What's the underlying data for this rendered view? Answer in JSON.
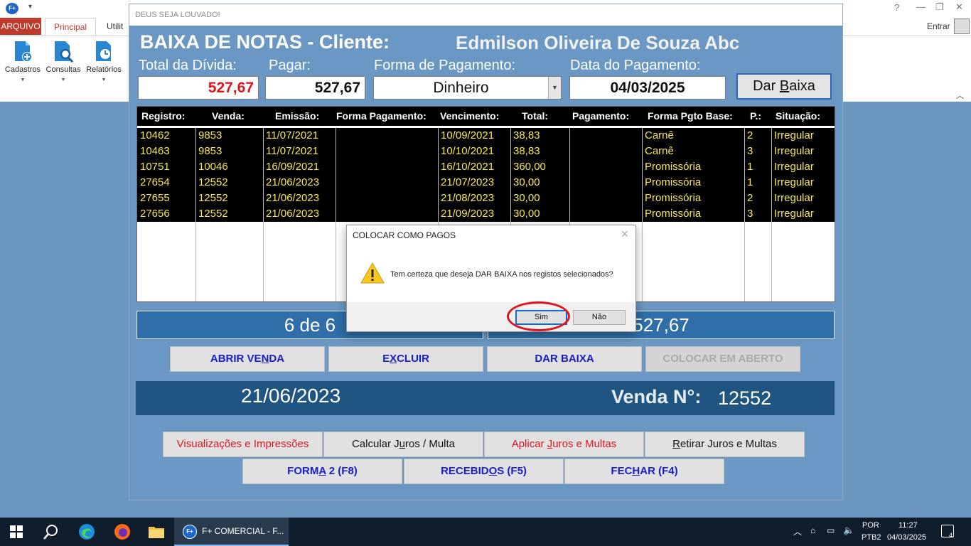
{
  "ribbon": {
    "tabs": {
      "arquivo": "ARQUIVO",
      "principal": "Principal",
      "utilitarios": "Utilit"
    },
    "buttons": {
      "cadastros": "Cadastros",
      "consultas": "Consultas",
      "relatorios": "Relatórios"
    },
    "entrar": "Entrar",
    "logo": "F+"
  },
  "form": {
    "window_title": "DEUS SEJA LOUVADO!",
    "title": "BAIXA DE NOTAS - Cliente:",
    "client_name": "Edmilson Oliveira De Souza Abc",
    "labels": {
      "total_divida": "Total da Dívida:",
      "pagar": "Pagar:",
      "forma_pagamento": "Forma de Pagamento:",
      "data_pagamento": "Data do Pagamento:"
    },
    "values": {
      "total_divida": "527,67",
      "pagar": "527,67",
      "forma_pagamento": "Dinheiro",
      "data_pagamento": "04/03/2025"
    },
    "dar_baixa_top": {
      "pre": "Dar ",
      "key": "B",
      "post": "aixa"
    }
  },
  "grid": {
    "headers": [
      "Registro:",
      "Venda:",
      "Emissão:",
      "Forma Pagamento:",
      "Vencimento:",
      "Total:",
      "Pagamento:",
      "Forma Pgto Base:",
      "P.:",
      "Situação:"
    ],
    "rows": [
      [
        "10462",
        "9853",
        "11/07/2021",
        "",
        "10/09/2021",
        "38,83",
        "",
        "Carnê",
        "2",
        "Irregular"
      ],
      [
        "10463",
        "9853",
        "11/07/2021",
        "",
        "10/10/2021",
        "38,83",
        "",
        "Carnê",
        "3",
        "Irregular"
      ],
      [
        "10751",
        "10046",
        "16/09/2021",
        "",
        "16/10/2021",
        "360,00",
        "",
        "Promissória",
        "1",
        "Irregular"
      ],
      [
        "27654",
        "12552",
        "21/06/2023",
        "",
        "21/07/2023",
        "30,00",
        "",
        "Promissória",
        "1",
        "Irregular"
      ],
      [
        "27655",
        "12552",
        "21/06/2023",
        "",
        "21/08/2023",
        "30,00",
        "",
        "Promissória",
        "2",
        "Irregular"
      ],
      [
        "27656",
        "12552",
        "21/06/2023",
        "",
        "21/09/2023",
        "30,00",
        "",
        "Promissória",
        "3",
        "Irregular"
      ]
    ]
  },
  "summary": {
    "count": "6 de 6",
    "total": "527,67"
  },
  "actions": {
    "abrir_venda": {
      "pre": "ABRIR VE",
      "key": "N",
      "post": "DA"
    },
    "excluir": {
      "pre": "E",
      "key": "X",
      "post": "CLUIR"
    },
    "dar_baixa": "DAR BAIXA",
    "colocar_em_aberto": "COLOCAR EM ABERTO"
  },
  "info": {
    "date": "21/06/2023",
    "venda_label": "Venda N°:",
    "venda_num": "12552"
  },
  "bottom": {
    "visualizacoes": "Visualizações e Impressões",
    "calcular": {
      "pre": "Calcular J",
      "key": "u",
      "post": "ros / Multa"
    },
    "aplicar": {
      "pre": "Aplicar ",
      "key": "J",
      "post": "uros e Multas"
    },
    "retirar": {
      "pre": "",
      "key": "R",
      "post": "etirar Juros e Multas"
    },
    "forma2": {
      "pre": "FORM",
      "key": "A",
      "post": " 2 (F8)"
    },
    "recebidos": {
      "pre": "RECEBID",
      "key": "O",
      "post": "S (F5)"
    },
    "fechar": {
      "pre": "FEC",
      "key": "H",
      "post": "AR (F4)"
    }
  },
  "dialog": {
    "title": "COLOCAR COMO PAGOS",
    "message": "Tem certeza que deseja DAR BAIXA nos registos selecionados?",
    "sim": "Sim",
    "nao": "Não"
  },
  "taskbar": {
    "app_label": "F+ COMERCIAL - F...",
    "lang1": "POR",
    "lang2": "PTB2",
    "time": "11:27",
    "date": "04/03/2025",
    "notif_count": "4"
  },
  "colors": {
    "accent_red": "#e0141e",
    "grid_text": "#f7e94a",
    "action_blue": "#1a1ad0",
    "form_bg": "#6a97c3"
  },
  "icons": [
    "app-logo-icon",
    "cadastros-icon",
    "consultas-icon",
    "relatorios-icon",
    "warning-icon",
    "windows-start-icon",
    "search-icon",
    "edge-icon",
    "firefox-icon",
    "file-explorer-icon"
  ]
}
